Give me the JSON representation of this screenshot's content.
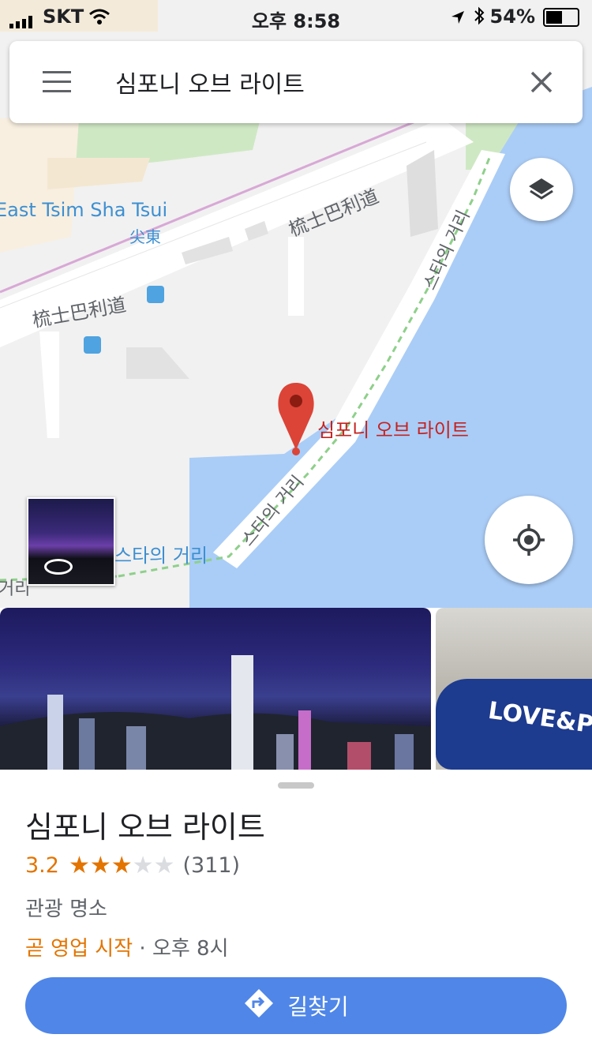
{
  "status_bar": {
    "carrier": "SKT",
    "time": "오후 8:58",
    "battery": "54%"
  },
  "search": {
    "query": "심포니 오브 라이트"
  },
  "map": {
    "labels": {
      "area_en": "East Tsim Sha Tsui",
      "area_zh": "尖東",
      "road1": "梳士巴利道",
      "road2": "梳士巴利道",
      "avenue_1": "스타의 거리",
      "avenue_2": "스타의 거리",
      "avenue_3": "스타의 거리",
      "avenue_4": "거리",
      "place_label": "심포니 오브 라이트"
    },
    "colors": {
      "water": "#aacdf7",
      "land": "#f1f1f1",
      "park": "#cfe8c4",
      "road": "#ffffff",
      "pin": "#db4437"
    }
  },
  "place": {
    "name": "심포니 오브 라이트",
    "rating": "3.2",
    "stars_filled": 3,
    "stars_total": 5,
    "review_count": "(311)",
    "category": "관광 명소",
    "hours_status": "곧 영업 시작",
    "hours_separator": " · ",
    "hours_time": "오후 8시"
  },
  "photos": {
    "main_icon": "city-skyline-photo",
    "second_text": "LOVE&P"
  },
  "actions": {
    "directions_label": "길찾기"
  }
}
